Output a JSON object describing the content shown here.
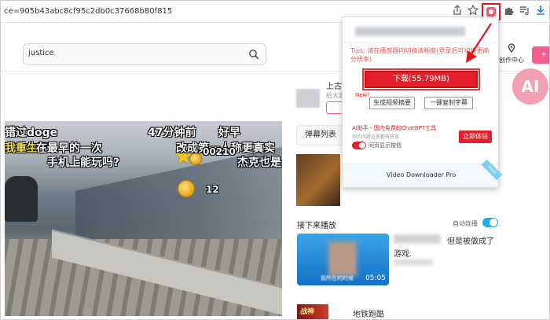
{
  "browser": {
    "url": "ce=905b43abc8cf95c2db0c37668b80f815",
    "icons": [
      "share-icon",
      "star-icon",
      "extension-icon",
      "puzzle-icon",
      "playlist-icon",
      "download-icon"
    ]
  },
  "header": {
    "search_value": "justice",
    "creator_label": "创作中心"
  },
  "video": {
    "danmaku": [
      {
        "text": "错过doge",
        "color": "#ffffff"
      },
      {
        "text": "我重生了",
        "color": "#f4e04d"
      },
      {
        "text": "好早",
        "color": "#ffffff"
      },
      {
        "text": "47分钟前",
        "color": "#ffffff"
      },
      {
        "text": "改成第一人称更真实",
        "color": "#ffffff"
      },
      {
        "text": "在最早的一次",
        "color": "#ffffff"
      },
      {
        "text": "手机上能玩吗?",
        "color": "#ffffff"
      },
      {
        "text": "杰克也是",
        "color": "#ffffff"
      },
      {
        "text": "00210",
        "color": "#ffffff"
      },
      {
        "text": "12",
        "color": "#ffffff"
      }
    ]
  },
  "sidebar": {
    "uploader_name": "上古",
    "uploader_sub": "给大家",
    "danmaku_list_label": "弹幕列表",
    "next_label": "接下来播放",
    "autoplay_label": "自动连播",
    "next_video": {
      "duration": "05:05",
      "caption": "我所在的时候",
      "title": "但是被做成了",
      "line2": "游戏."
    },
    "second_video": {
      "thumb_text": "战神",
      "title": "地铁跑酷"
    },
    "ai_badge": "AI"
  },
  "popup": {
    "tips": "Tips: 请在播放器内切换清晰度(登录后可切换更高分辨率)",
    "download_label": "下载(55.79MB)",
    "new_tag": "New!",
    "summary_label": "生成视频摘要",
    "subtitle_label": "一键复制字幕",
    "ai_line": "AI助手 - 国内免费的ChatGPT工具",
    "ai_subline": "你的问题这里都有答案",
    "sync_label": "同页显示按钮",
    "try_label": "立即体验",
    "vdp_label": "Video Downloader Pro",
    "ribbon": "more"
  },
  "colors": {
    "accent_red": "#e5202a",
    "highlight_red": "#e0161c",
    "bili_pink": "#f25d8e",
    "bili_blue": "#23ade5"
  }
}
